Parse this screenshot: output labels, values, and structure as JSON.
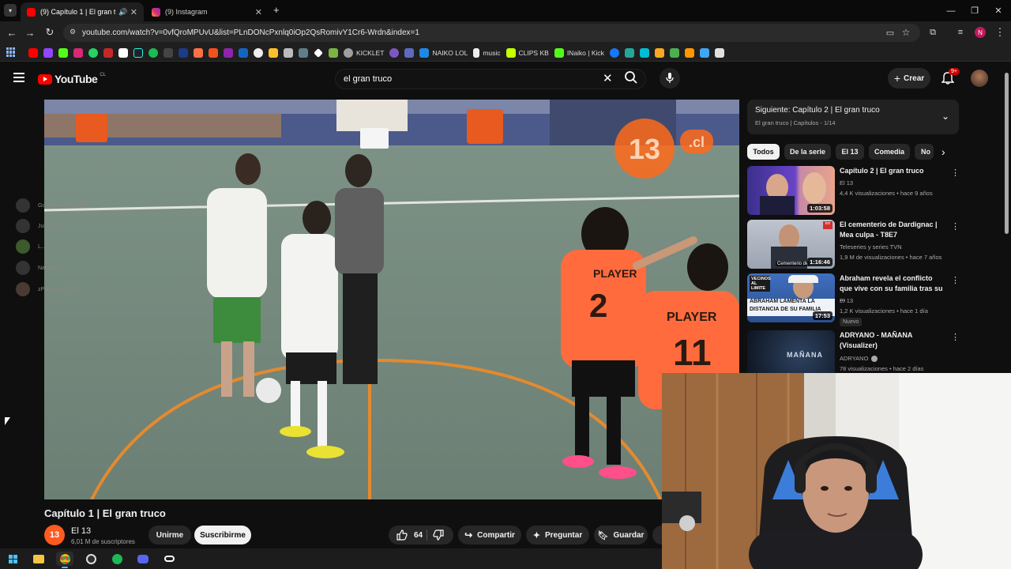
{
  "browser": {
    "tabs": [
      {
        "title": "(9) Capítulo 1 | El gran truco",
        "active": true
      },
      {
        "title": "(9) Instagram",
        "active": false
      }
    ],
    "url": "youtube.com/watch?v=0vfQroMPUvU&list=PLnDONcPxnlq0iOp2QsRomivY1Cr6-Wrdn&index=1",
    "bookmarks": [
      "KICKLET",
      "NAIKO LOL",
      "music",
      "CLIPS KB",
      "INaiko | Kick"
    ]
  },
  "youtube": {
    "logo_text": "YouTube",
    "region": "CL",
    "search_value": "el gran truco",
    "create_label": "Crear",
    "notif_count": "9+"
  },
  "video": {
    "title": "Capítulo 1 | El gran truco",
    "channel": "El 13",
    "channel_initial": "13",
    "subscribers": "6,01 M de suscriptores",
    "join_label": "Unirme",
    "subscribe_label": "Suscribirme",
    "likes": "64",
    "share_label": "Compartir",
    "ask_label": "Preguntar",
    "save_label": "Guardar",
    "jersey_text": "PLAYER",
    "jersey_numbers": [
      "2",
      "11"
    ],
    "logo_overlay": "13",
    "logo_suffix": ".cl"
  },
  "discord_overlay": [
    "Gordi RickyBrandon",
    "Julianconk",
    "L...",
    "Nachato",
    "zPancrasex  COB"
  ],
  "playlist": {
    "next_label": "Siguiente: Capítulo 2 | El gran truco",
    "subtitle": "El gran truco | Capítulos - 1/14"
  },
  "chips": [
    "Todos",
    "De la serie",
    "El 13",
    "Comedia",
    "No"
  ],
  "recommendations": [
    {
      "title": "Capítulo 2 | El gran truco",
      "channel": "El 13",
      "meta": "4,4 K visualizaciones • hace 9 años",
      "duration": "1:03:58",
      "badge": ""
    },
    {
      "title": "El cementerio de Dardignac | Mea culpa - T8E7",
      "channel": "Teleseries y series TVN",
      "meta": "1,9 M de visualizaciones • hace 7 años",
      "duration": "1:16:46",
      "badge": ""
    },
    {
      "title": "Abraham revela el conflicto que vive con su familia tras su ...",
      "channel": "El 13",
      "meta": "1,2 K visualizaciones • hace 1 día",
      "duration": "17:53",
      "badge": "Nuevo"
    },
    {
      "title": "ADRYANO - MAÑANA (Visualizer)",
      "channel": "ADRYANO",
      "meta": "78 visualizaciones • hace 2 días",
      "duration": "",
      "badge": ""
    }
  ],
  "thumb_text": {
    "vecinos": "VECINOS AL LIMITE",
    "abraham_line1": "ABRAHAM LAMENTA LA",
    "abraham_line2": "DISTANCIA DE SU FAMILIA",
    "cementerio": "Cementerio de",
    "manana": "MAÑANA",
    "tvn": "tvn"
  }
}
